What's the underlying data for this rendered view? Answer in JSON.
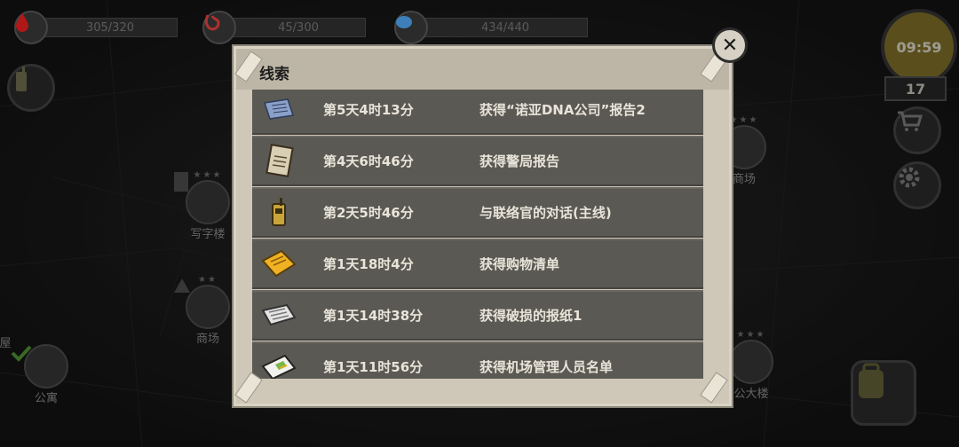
{
  "hud": {
    "blood": {
      "value": "305/320",
      "icon": "blood-drop-icon"
    },
    "hunger": {
      "value": "45/300",
      "icon": "stomach-icon"
    },
    "mind": {
      "value": "434/440",
      "icon": "brain-icon"
    },
    "clock": "09:59",
    "day": "17"
  },
  "map": {
    "locations": [
      {
        "label": "写字楼"
      },
      {
        "label": "商场"
      },
      {
        "label": "公寓"
      },
      {
        "label": "屋"
      },
      {
        "label": "商场"
      },
      {
        "label": "公大楼"
      }
    ]
  },
  "clues": {
    "title": "线索",
    "items": [
      {
        "time": "第5天4时13分",
        "desc": "获得“诺亚DNA公司”报告2",
        "icon": "scroll-icon"
      },
      {
        "time": "第4天6时46分",
        "desc": "获得警局报告",
        "icon": "report-icon"
      },
      {
        "time": "第2天5时46分",
        "desc": "与联络官的对话(主线)",
        "icon": "walkie-talkie-icon"
      },
      {
        "time": "第1天18时4分",
        "desc": "获得购物清单",
        "icon": "notepad-icon"
      },
      {
        "time": "第1天14时38分",
        "desc": "获得破损的报纸1",
        "icon": "newspaper-icon"
      },
      {
        "time": "第1天11时56分",
        "desc": "获得机场管理人员名单",
        "icon": "map-list-icon"
      }
    ],
    "close": "✕"
  }
}
